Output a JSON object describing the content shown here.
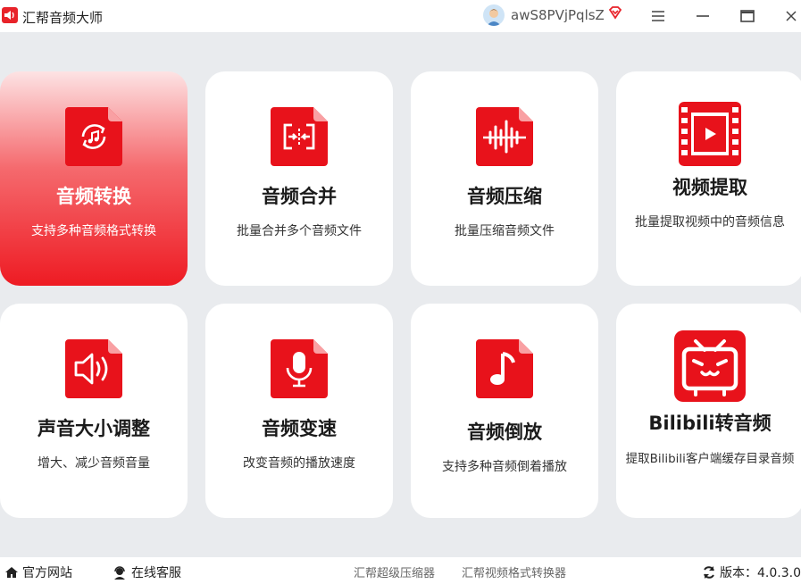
{
  "app": {
    "title": "汇帮音频大师"
  },
  "user": {
    "name": "awS8PVjPqlsZ"
  },
  "colors": {
    "accent": "#ee1b23",
    "background": "#e9ebee"
  },
  "tools": [
    {
      "title": "音频转换",
      "desc": "支持多种音频格式转换",
      "icon": "audio-convert-icon",
      "active": true
    },
    {
      "title": "音频合并",
      "desc": "批量合并多个音频文件",
      "icon": "audio-merge-icon"
    },
    {
      "title": "音频压缩",
      "desc": "批量压缩音频文件",
      "icon": "audio-compress-icon"
    },
    {
      "title": "视频提取",
      "desc": "批量提取视频中的音频信息",
      "icon": "video-extract-icon"
    },
    {
      "title": "声音大小调整",
      "desc": "增大、减少音频音量",
      "icon": "volume-adjust-icon"
    },
    {
      "title": "音频变速",
      "desc": "改变音频的播放速度",
      "icon": "audio-speed-icon"
    },
    {
      "title": "音频倒放",
      "desc": "支持多种音频倒着播放",
      "icon": "audio-reverse-icon"
    },
    {
      "title": "Bilibili转音频",
      "desc": "提取Bilibili客户端缓存目录音频",
      "icon": "bilibili-icon"
    }
  ],
  "footer": {
    "website": "官方网站",
    "support": "在线客服",
    "link1": "汇帮超级压缩器",
    "link2": "汇帮视频格式转换器",
    "version": "版本：4.0.3.0"
  }
}
